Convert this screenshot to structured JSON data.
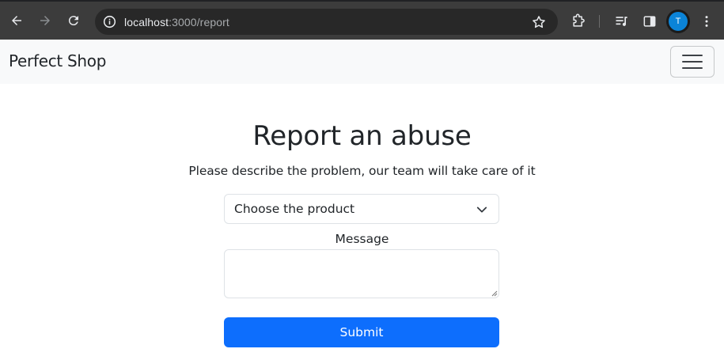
{
  "browser": {
    "url_host": "localhost",
    "url_path": ":3000/report",
    "profile_initial": "T"
  },
  "navbar": {
    "brand": "Perfect Shop"
  },
  "form": {
    "title": "Report an abuse",
    "subtitle": "Please describe the problem, our team will take care of it",
    "product_select_value": "Choose the product",
    "message_label": "Message",
    "message_value": "",
    "submit_label": "Submit"
  },
  "colors": {
    "chrome_bg": "#3c3c3c",
    "navbar_bg": "#f8f9fa",
    "primary": "#0d6efd",
    "avatar": "#0b84d8"
  }
}
